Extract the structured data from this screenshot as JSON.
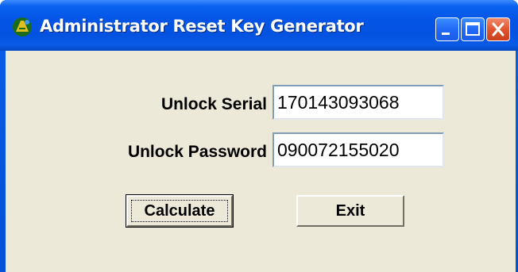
{
  "window": {
    "title": "Administrator Reset Key Generator",
    "title_bar_color": "#0454e6",
    "client_bg_color": "#ece9d8"
  },
  "title_buttons": {
    "minimize_icon": "minimize-icon",
    "maximize_icon": "maximize-icon",
    "close_icon": "close-icon"
  },
  "form": {
    "serial_label": "Unlock Serial",
    "serial_value": "170143093068",
    "password_label": "Unlock Password",
    "password_value": "090072155020"
  },
  "buttons": {
    "calculate_label": "Calculate",
    "exit_label": "Exit"
  }
}
